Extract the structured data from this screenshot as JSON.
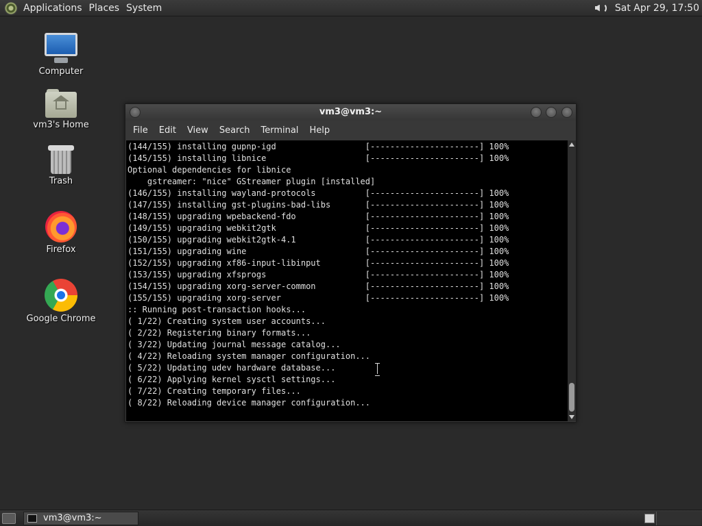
{
  "top_panel": {
    "menus": [
      "Applications",
      "Places",
      "System"
    ],
    "clock": "Sat Apr 29, 17:50",
    "volume_icon": "speaker-volume-icon",
    "menu_logo_icon": "main-menu-logo-icon"
  },
  "desktop_icons": [
    {
      "label": "Computer",
      "icon": "computer-icon"
    },
    {
      "label": "vm3's Home",
      "icon": "home-folder-icon"
    },
    {
      "label": "Trash",
      "icon": "trash-icon"
    },
    {
      "label": "Firefox",
      "icon": "firefox-icon"
    },
    {
      "label": "Google Chrome",
      "icon": "chrome-icon"
    }
  ],
  "terminal": {
    "title": "vm3@vm3:~",
    "menu": [
      "File",
      "Edit",
      "View",
      "Search",
      "Terminal",
      "Help"
    ],
    "lines": [
      "(144/155) installing gupnp-igd                  [----------------------] 100%",
      "(145/155) installing libnice                    [----------------------] 100%",
      "Optional dependencies for libnice",
      "    gstreamer: \"nice\" GStreamer plugin [installed]",
      "(146/155) installing wayland-protocols          [----------------------] 100%",
      "(147/155) installing gst-plugins-bad-libs       [----------------------] 100%",
      "(148/155) upgrading wpebackend-fdo              [----------------------] 100%",
      "(149/155) upgrading webkit2gtk                  [----------------------] 100%",
      "(150/155) upgrading webkit2gtk-4.1              [----------------------] 100%",
      "(151/155) upgrading wine                        [----------------------] 100%",
      "(152/155) upgrading xf86-input-libinput         [----------------------] 100%",
      "(153/155) upgrading xfsprogs                    [----------------------] 100%",
      "(154/155) upgrading xorg-server-common          [----------------------] 100%",
      "(155/155) upgrading xorg-server                 [----------------------] 100%",
      ":: Running post-transaction hooks...",
      "( 1/22) Creating system user accounts...",
      "( 2/22) Registering binary formats...",
      "( 3/22) Updating journal message catalog...",
      "( 4/22) Reloading system manager configuration...",
      "( 5/22) Updating udev hardware database...",
      "( 6/22) Applying kernel sysctl settings...",
      "( 7/22) Creating temporary files...",
      "( 8/22) Reloading device manager configuration..."
    ]
  },
  "bottom_panel": {
    "task_label": "vm3@vm3:~",
    "show_desktop_icon": "show-desktop-icon",
    "task_icon": "terminal-icon"
  },
  "colors": {
    "desktop_bg": "#2a2a2a",
    "terminal_bg": "#000000",
    "terminal_fg": "#e0e0e0"
  }
}
